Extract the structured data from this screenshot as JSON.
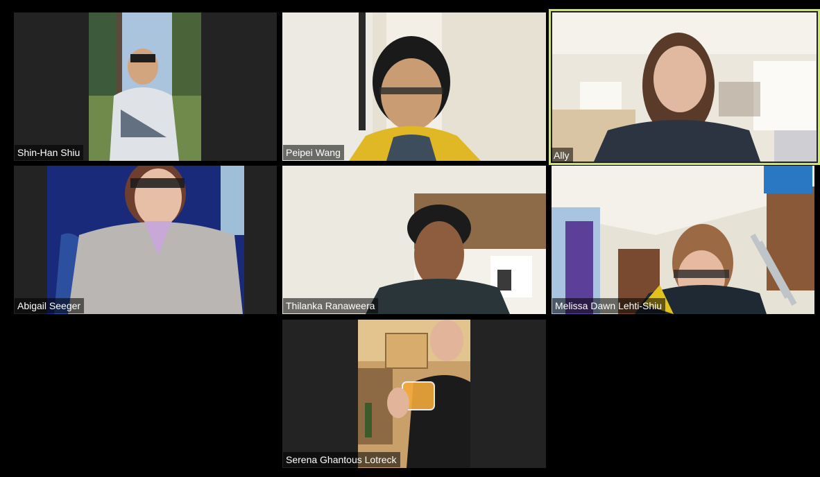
{
  "participants": [
    {
      "name": "Shin-Han Shiu",
      "active_speaker": false,
      "video_on": true
    },
    {
      "name": "Peipei Wang",
      "active_speaker": false,
      "video_on": true
    },
    {
      "name": "Ally",
      "active_speaker": true,
      "video_on": true
    },
    {
      "name": "Abigail Seeger",
      "active_speaker": false,
      "video_on": true
    },
    {
      "name": "Thilanka Ranaweera",
      "active_speaker": false,
      "video_on": true
    },
    {
      "name": "Melissa Dawn Lehti-Shiu",
      "active_speaker": false,
      "video_on": true
    },
    {
      "name": "Serena Ghantous Lotreck",
      "active_speaker": false,
      "video_on": true
    }
  ],
  "colors": {
    "background": "#000000",
    "tile_background": "#232323",
    "active_speaker_border": "#c9e86a",
    "label_text": "#ffffff"
  }
}
